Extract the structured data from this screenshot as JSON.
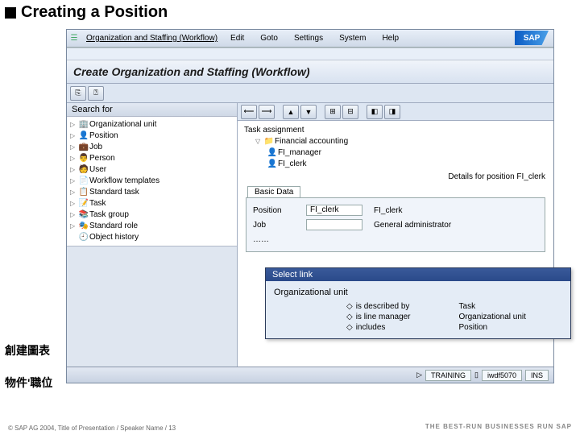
{
  "slide": {
    "title": "Creating a Position"
  },
  "menubar": {
    "title": "Organization and Staffing (Workflow)",
    "items": [
      "Edit",
      "Goto",
      "Settings",
      "System",
      "Help"
    ],
    "logo": "SAP"
  },
  "page_title": "Create Organization and Staffing (Workflow)",
  "search": {
    "header": "Search for",
    "items": [
      "Organizational unit",
      "Position",
      "Job",
      "Person",
      "User",
      "Workflow templates",
      "Standard task",
      "Task",
      "Task group",
      "Standard role",
      "Object history"
    ]
  },
  "task": {
    "header": "Task assignment",
    "root": "Financial accounting",
    "children": [
      "FI_manager",
      "FI_clerk"
    ]
  },
  "details": {
    "header": "Details for position FI_clerk",
    "tab": "Basic Data",
    "position_label": "Position",
    "position_code": "FI_clerk",
    "position_name": "FI_clerk",
    "job_label": "Job",
    "job_name": "General administrator",
    "more": "……"
  },
  "statusbar": {
    "client_label": "TRAINING",
    "session": "iwdf5070",
    "mode": "INS"
  },
  "popup": {
    "title": "Select link",
    "heading": "Organizational unit",
    "left": [
      "is described by",
      "is line manager",
      "includes"
    ],
    "right": [
      "Task",
      "Organizational unit",
      "Position"
    ]
  },
  "annotations": {
    "a1": "創建圖表",
    "a2": "物件'職位"
  },
  "footer": {
    "copyright": "© SAP AG 2004, Title of Presentation / Speaker Name / 13",
    "brand": "THE BEST-RUN BUSINESSES RUN SAP"
  }
}
